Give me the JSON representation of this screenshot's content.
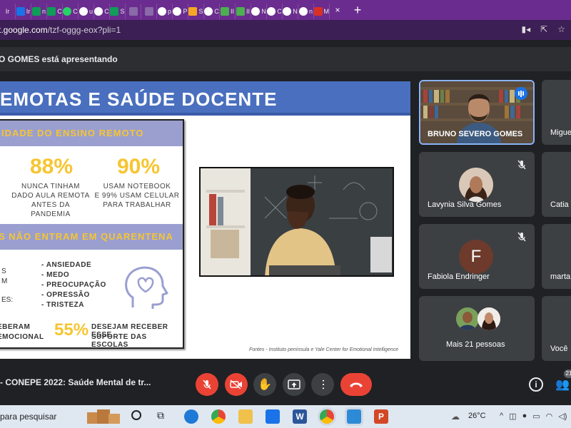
{
  "browser": {
    "tab_labels": [
      "Ir",
      "n",
      "C",
      "C",
      "u",
      "C",
      "S",
      "",
      "",
      "p",
      "P",
      "S",
      "C",
      "II",
      "II",
      "N",
      "C",
      "N",
      "n",
      "M"
    ],
    "url_host": "t.google.com",
    "url_path": "/tzf-oggg-eox?pli=1",
    "new_tab_label": "+"
  },
  "meet": {
    "presenting_text": "O GOMES está apresentando",
    "meeting_name": "- CONEPE 2022: Saúde Mental de tr...",
    "participant_count_badge": "21"
  },
  "slide": {
    "title": "EMOTAS E SAÚDE DOCENTE",
    "band1": "IDADE DO ENSINO REMOTO",
    "stat1_value": "88%",
    "stat1_text": [
      "NUNCA TINHAM",
      "DADO AULA REMOTA",
      "ANTES DA PANDEMIA"
    ],
    "stat2_value": "90%",
    "stat2_text": [
      "USAM NOTEBOOK",
      "E 99% USAM CELULAR",
      "PARA TRABALHAR"
    ],
    "band2": "S NÃO ENTRAM EM QUARENTENA",
    "left_fragments": [
      "S",
      "M",
      "ES:"
    ],
    "symptoms": [
      "- ANSIEDADE",
      "- MEDO",
      "- PREOCUPAÇÃO",
      "- OPRESSÃO",
      "- TRISTEZA"
    ],
    "bottom_left_1": "EBERAM",
    "bottom_left_2": "EMOCIONAL",
    "stat3_value": "55%",
    "stat3_text": [
      "DESEJAM RECEBER ESSE",
      "SUPORTE DAS ESCOLAS"
    ],
    "sources": "Fontes - Instituto península e Yale Center for Emotional Intelligence"
  },
  "participants": [
    {
      "name": "BRUNO SEVERO GOMES"
    },
    {
      "name": "Migue"
    },
    {
      "name": "Lavynia Silva Gomes"
    },
    {
      "name": "Catia"
    },
    {
      "name": "Fabiola Endringer",
      "initial": "F"
    },
    {
      "name": "marta"
    },
    {
      "name": "Mais 21 pessoas"
    },
    {
      "name": "Você"
    }
  ],
  "taskbar": {
    "search_text": "para pesquisar",
    "weather": "26°C"
  },
  "colors": {
    "tab_strip": "#6a2c8e",
    "slide_title_bar": "#4a6fbe",
    "slide_band": "#9a9fd0",
    "stat_yellow": "#f7c531",
    "end_call_red": "#ea4335",
    "tile_bg": "#3c4043",
    "active_speaker_border": "#8ab4f8"
  }
}
